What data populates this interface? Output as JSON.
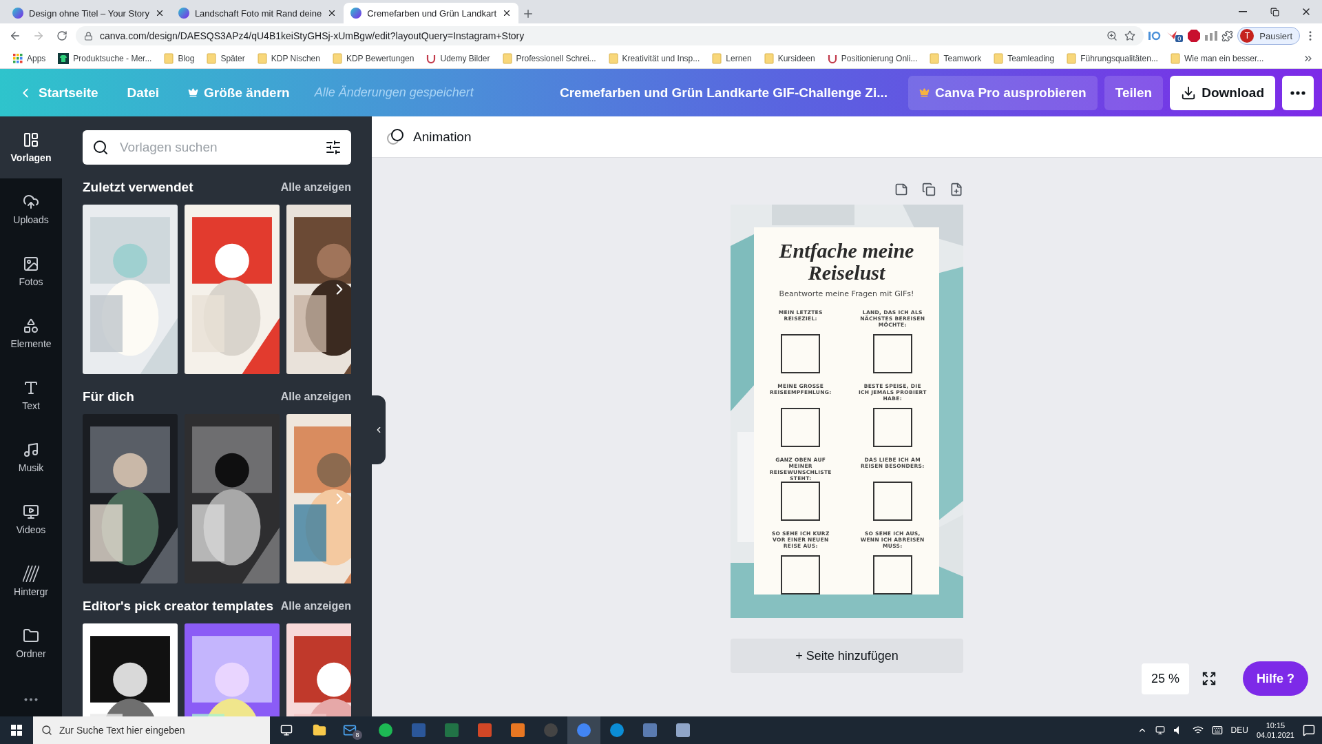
{
  "browser": {
    "tabs": [
      {
        "title": "Design ohne Titel – Your Story",
        "selected": false
      },
      {
        "title": "Landschaft Foto mit Rand deine",
        "selected": false
      },
      {
        "title": "Cremefarben und Grün Landkart",
        "selected": true
      }
    ],
    "url": "canva.com/design/DAESQS3APz4/qU4B1keiStyGHSj-xUmBgw/edit?layoutQuery=Instagram+Story",
    "extension_badge": "0",
    "profile": {
      "initial": "T",
      "label": "Pausiert"
    },
    "bookmarks": [
      {
        "label": "Apps",
        "kind": "apps"
      },
      {
        "label": "Produktsuche - Mer...",
        "kind": "site"
      },
      {
        "label": "Blog",
        "kind": "folder"
      },
      {
        "label": "Später",
        "kind": "folder"
      },
      {
        "label": "KDP Nischen",
        "kind": "folder"
      },
      {
        "label": "KDP Bewertungen",
        "kind": "folder"
      },
      {
        "label": "Udemy Bilder",
        "kind": "udemy"
      },
      {
        "label": "Professionell Schrei...",
        "kind": "folder"
      },
      {
        "label": "Kreativität und Insp...",
        "kind": "folder"
      },
      {
        "label": "Lernen",
        "kind": "folder"
      },
      {
        "label": "Kursideen",
        "kind": "folder"
      },
      {
        "label": "Positionierung Onli...",
        "kind": "udemy"
      },
      {
        "label": "Teamwork",
        "kind": "folder"
      },
      {
        "label": "Teamleading",
        "kind": "folder"
      },
      {
        "label": "Führungsqualitäten...",
        "kind": "folder"
      },
      {
        "label": "Wie man ein besser...",
        "kind": "folder"
      }
    ]
  },
  "header": {
    "back": "Startseite",
    "file": "Datei",
    "resize": "Größe ändern",
    "save_status": "Alle Änderungen gespeichert",
    "title": "Cremefarben und Grün Landkarte GIF-Challenge Zi...",
    "pro": "Canva Pro ausprobieren",
    "share": "Teilen",
    "download": "Download"
  },
  "sidebar": {
    "items": [
      {
        "label": "Vorlagen",
        "selected": true
      },
      {
        "label": "Uploads",
        "selected": false
      },
      {
        "label": "Fotos",
        "selected": false
      },
      {
        "label": "Elemente",
        "selected": false
      },
      {
        "label": "Text",
        "selected": false
      },
      {
        "label": "Musik",
        "selected": false
      },
      {
        "label": "Videos",
        "selected": false
      },
      {
        "label": "Hintergr",
        "selected": false
      },
      {
        "label": "Ordner",
        "selected": false
      }
    ]
  },
  "panel": {
    "search": {
      "placeholder": "Vorlagen suchen"
    },
    "sections": [
      {
        "title": "Zuletzt verwendet",
        "link": "Alle anzeigen"
      },
      {
        "title": "Für dich",
        "link": "Alle anzeigen"
      },
      {
        "title": "Editor's pick creator templates",
        "link": "Alle anzeigen"
      }
    ]
  },
  "toolbar": {
    "animation": "Animation"
  },
  "design": {
    "title": "Entfache meine Reiselust",
    "subtitle": "Beantworte meine Fragen mit GIFs!",
    "prompts": [
      "MEIN LETZTES REISEZIEL:",
      "LAND, DAS ICH ALS NÄCHSTES BEREISEN MÖCHTE:",
      "MEINE GROSSE REISEEMPFEHLUNG:",
      "BESTE SPEISE, DIE ICH JEMALS PROBIERT HABE:",
      "GANZ OBEN AUF MEINER REISEWUNSCHLISTE STEHT:",
      "DAS LIEBE ICH AM REISEN BESONDERS:",
      "SO SEHE ICH KURZ VOR EINER NEUEN REISE AUS:",
      "SO SEHE ICH AUS, WENN ICH ABREISEN MUSS:"
    ]
  },
  "add_page": "+ Seite hinzufügen",
  "zoom": {
    "reading": "25 %"
  },
  "help": "Hilfe ?",
  "taskbar": {
    "search_placeholder": "Zur Suche Text hier eingeben",
    "mail_badge": "8",
    "language": "DEU",
    "time": "10:15",
    "date": "04.01.2021"
  }
}
